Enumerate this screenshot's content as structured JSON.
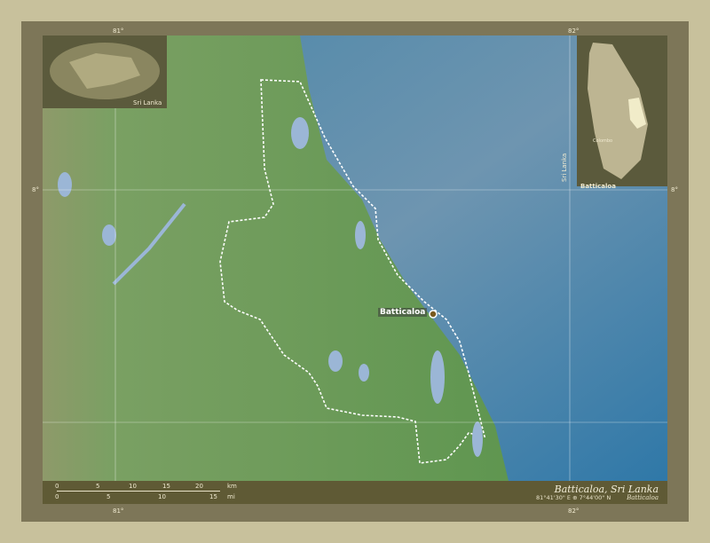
{
  "title": "Batticaloa, Sri Lanka",
  "coordinates": "81°41'30\" E ⊕ 7°44'00\" N",
  "legend_label": "Batticaloa",
  "city_label": "Batticaloa",
  "inset_world": {
    "label": "Sri Lanka"
  },
  "inset_country": {
    "country_label": "Sri Lanka",
    "region_label": "Batticaloa",
    "capital_label": "Colombo"
  },
  "graticule": {
    "lon_left": "81°",
    "lon_right": "82°",
    "lat_label": "8°"
  },
  "scale": {
    "km_ticks": [
      "0",
      "5",
      "10",
      "15",
      "20"
    ],
    "km_unit": "km",
    "mi_ticks": [
      "0",
      "5",
      "10",
      "15"
    ],
    "mi_unit": "mi"
  },
  "colors": {
    "land": "#6f9a58",
    "sea": "#3d7fa6",
    "frame": "#c8c19c",
    "inset": "#5b5a3c",
    "highlight": "#f1ecc9"
  }
}
